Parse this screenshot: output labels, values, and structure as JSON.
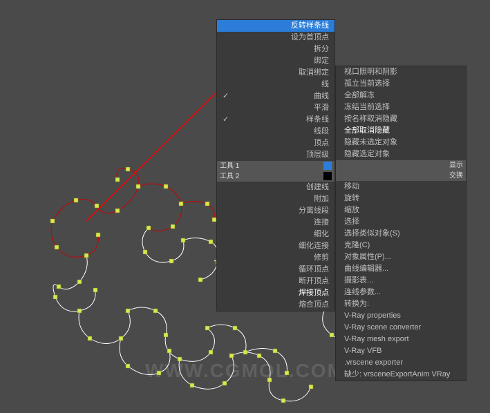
{
  "watermark": "WWW.CGMOL.COM",
  "menu_left": {
    "items": [
      {
        "label": "反转样条线",
        "highlighted": true
      },
      {
        "label": "设为首顶点"
      },
      {
        "label": "拆分"
      },
      {
        "label": "绑定"
      },
      {
        "label": "取消绑定"
      },
      {
        "label": "线"
      },
      {
        "label": "曲线",
        "check": true
      },
      {
        "label": "平滑"
      },
      {
        "label": "样条线",
        "check": true
      },
      {
        "label": "线段"
      },
      {
        "label": "顶点"
      },
      {
        "label": "顶层级"
      }
    ],
    "tool1": "工具 1",
    "tool2": "工具 2",
    "items2": [
      {
        "label": "创建线"
      },
      {
        "label": "附加"
      },
      {
        "label": "分离线段"
      },
      {
        "label": "连接"
      },
      {
        "label": "细化"
      },
      {
        "label": "细化连接"
      },
      {
        "label": "修剪"
      },
      {
        "label": "循环顶点"
      },
      {
        "label": "断开顶点"
      },
      {
        "label": "焊接顶点",
        "highlight_blue": true
      },
      {
        "label": "熔合顶点"
      }
    ]
  },
  "menu_right": {
    "items": [
      {
        "label": "视口照明和阴影"
      },
      {
        "label": "孤立当前选择"
      },
      {
        "label": "全部解冻"
      },
      {
        "label": "冻结当前选择"
      },
      {
        "label": "按名称取消隐藏"
      },
      {
        "label": "全部取消隐藏",
        "highlight": true
      },
      {
        "label": "隐藏未选定对象"
      },
      {
        "label": "隐藏选定对象"
      }
    ],
    "tool_label_show": "显示",
    "tool_label_render": "交换",
    "items2": [
      {
        "label": "移动"
      },
      {
        "label": "旋转"
      },
      {
        "label": "缩放"
      },
      {
        "label": "选择"
      },
      {
        "label": "选择类似对象(S)"
      },
      {
        "label": "克隆(C)"
      },
      {
        "label": "对象属性(P)..."
      },
      {
        "label": "曲线编辑器..."
      },
      {
        "label": "摄影表..."
      },
      {
        "label": "连线参数..."
      },
      {
        "label": "转换为:"
      },
      {
        "label": "V-Ray properties"
      },
      {
        "label": "V-Ray scene converter"
      },
      {
        "label": "V-Ray mesh export"
      },
      {
        "label": "V-Ray VFB"
      },
      {
        "label": ".vrscene exporter"
      },
      {
        "label": "缺少:  vrsceneExportAnim VRay"
      }
    ]
  }
}
